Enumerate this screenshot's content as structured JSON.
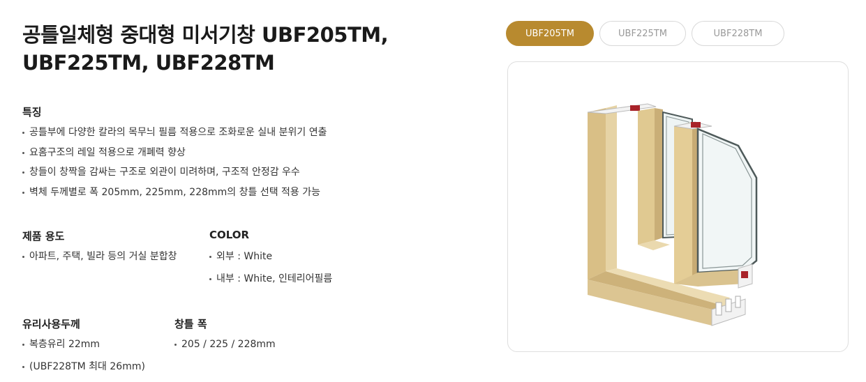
{
  "product": {
    "title_line1": "공틀일체형 중대형 미서기창 UBF205TM,",
    "title_line2": "UBF225TM, UBF228TM"
  },
  "features": {
    "heading": "특징",
    "items": [
      "공틀부에 다양한 칼라의 목무늬 필름 적용으로 조화로운 실내 분위기 연출",
      "요홈구조의 레일 적용으로 개폐력 향상",
      "창들이 창짝을 감싸는 구조로 외관이 미려하며, 구조적 안정감 우수",
      "벽체 두께별로 폭 205mm, 225mm, 228mm의 창틀 선택 적용 가능"
    ]
  },
  "usage": {
    "heading": "제품 용도",
    "items": [
      "아파트, 주택, 빌라 등의 거실 분합창"
    ]
  },
  "color": {
    "heading": "COLOR",
    "items": [
      "외부 : White",
      "내부 : White, 인테리어필름"
    ]
  },
  "glass": {
    "heading": "유리사용두께",
    "items": [
      "복층유리 22mm",
      "(UBF228TM 최대 26mm)"
    ]
  },
  "frame_width": {
    "heading": "창틀 폭",
    "items": [
      "205 / 225 / 228mm"
    ]
  },
  "model_tabs": [
    {
      "label": "UBF205TM",
      "active": true
    },
    {
      "label": "UBF225TM",
      "active": false
    },
    {
      "label": "UBF228TM",
      "active": false
    }
  ],
  "colors": {
    "accent": "#b88a2f",
    "wood": "#e3cc98",
    "frame_red": "#a8232a"
  }
}
